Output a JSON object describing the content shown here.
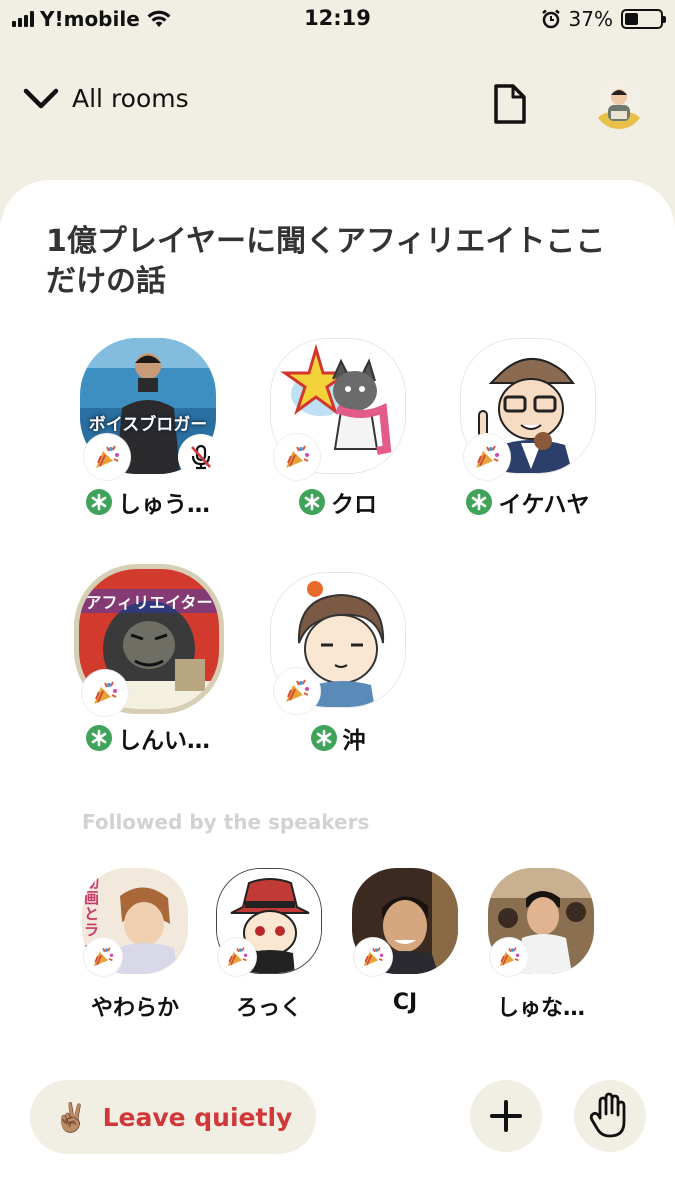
{
  "status_bar": {
    "carrier": "Y!mobile",
    "time": "12:19",
    "battery": "37%",
    "battery_level": 0.37
  },
  "header": {
    "back_label": "All rooms"
  },
  "room": {
    "title": "1億プレイヤーに聞くアフィリエイトここだけの話",
    "speakers": [
      {
        "name": "しゅう…",
        "overlay": "ボイスブロガー",
        "muted": true,
        "moderator": true
      },
      {
        "name": "クロ",
        "moderator": true
      },
      {
        "name": "イケハヤ",
        "moderator": true
      },
      {
        "name": "しんい…",
        "overlay": "アフィリエイター",
        "moderator": true
      },
      {
        "name": "沖",
        "moderator": true
      }
    ],
    "followed_label": "Followed by the speakers",
    "followed": [
      {
        "name": "やわらか",
        "overlay": "動画とライブ配"
      },
      {
        "name": "ろっく"
      },
      {
        "name": "CJ"
      },
      {
        "name": "しゅな…"
      }
    ]
  },
  "bottom": {
    "leave_emoji": "✌🏽",
    "leave_label": "Leave quietly"
  }
}
